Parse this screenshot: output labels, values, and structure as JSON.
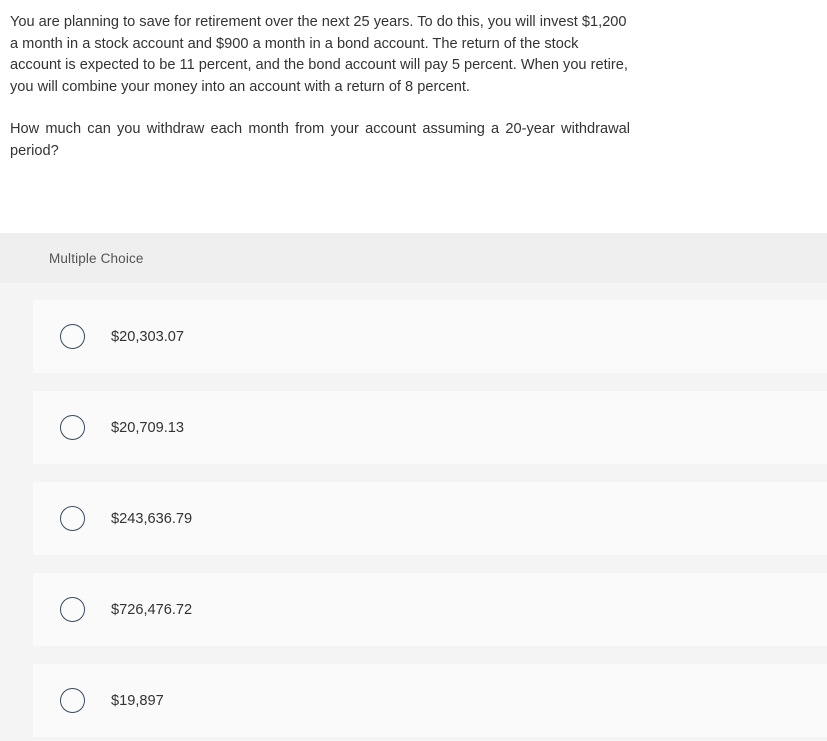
{
  "question": {
    "paragraph_1": "You are planning to save for retirement over the next 25 years. To do this, you will invest $1,200 a month in a stock account and $900 a month in a bond account. The return of the stock account is expected to be 11 percent, and the bond account will pay 5 percent. When you retire, you will combine your money into an account with a return of 8 percent.",
    "paragraph_2": "How much can you withdraw each month from your account assuming a 20-year withdrawal period?"
  },
  "answer_panel": {
    "header_label": "Multiple Choice",
    "options": [
      {
        "label": "$20,303.07",
        "selected": false
      },
      {
        "label": "$20,709.13",
        "selected": false
      },
      {
        "label": "$243,636.79",
        "selected": false
      },
      {
        "label": "$726,476.72",
        "selected": false
      },
      {
        "label": "$19,897",
        "selected": false
      }
    ]
  },
  "colors": {
    "page_background": "#ffffff",
    "panel_background": "#f4f4f4",
    "panel_header_background": "#efefef",
    "option_card_background": "#fafafa",
    "radio_border": "#3b4a5f",
    "text": "#333333",
    "header_text": "#545454"
  }
}
